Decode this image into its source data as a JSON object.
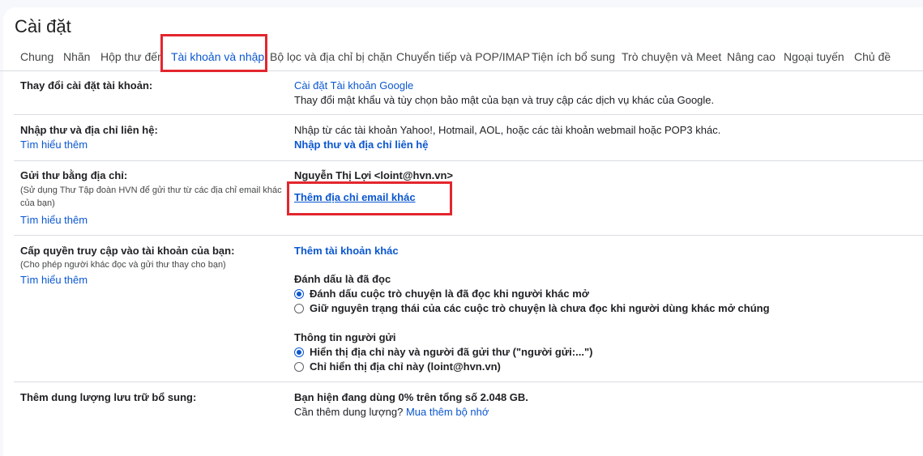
{
  "header": {
    "title": "Cài đặt"
  },
  "tabs": [
    {
      "label": "Chung",
      "active": false
    },
    {
      "label": "Nhãn",
      "active": false
    },
    {
      "label": "Hộp thư đến",
      "active": false
    },
    {
      "label": "Tài khoản và nhập",
      "active": true
    },
    {
      "label": "Bộ lọc và địa chỉ bị chặn",
      "active": false
    },
    {
      "label": "Chuyển tiếp và POP/IMAP",
      "active": false
    },
    {
      "label": "Tiện ích bổ sung",
      "active": false
    },
    {
      "label": "Trò chuyện và Meet",
      "active": false
    },
    {
      "label": "Nâng cao",
      "active": false
    },
    {
      "label": "Ngoại tuyến",
      "active": false
    },
    {
      "label": "Chủ đề",
      "active": false
    }
  ],
  "sections": {
    "change_account": {
      "label": "Thay đổi cài đặt tài khoản:",
      "link": "Cài đặt Tài khoản Google",
      "desc": "Thay đổi mật khẩu và tùy chọn bảo mật của bạn và truy cập các dịch vụ khác của Google."
    },
    "import": {
      "label": "Nhập thư và địa chỉ liên hệ:",
      "learn": "Tìm hiểu thêm",
      "desc": "Nhập từ các tài khoản Yahoo!, Hotmail, AOL, hoặc các tài khoản webmail hoặc POP3 khác.",
      "link": "Nhập thư và địa chỉ liên hệ"
    },
    "send_as": {
      "label": "Gửi thư bằng địa chỉ:",
      "sub": "(Sử dụng Thư Tập đoàn HVN để gửi thư từ các địa chỉ email khác của bạn)",
      "learn": "Tìm hiểu thêm",
      "address": "Nguyễn Thị Lợi <loint@hvn.vn>",
      "add_link": "Thêm địa chỉ email khác"
    },
    "grant": {
      "label": "Cấp quyền truy cập vào tài khoản của bạn:",
      "sub": "(Cho phép người khác đọc và gửi thư thay cho bạn)",
      "learn": "Tìm hiểu thêm",
      "add_link": "Thêm tài khoản khác",
      "mark_heading": "Đánh dấu là đã đọc",
      "mark_opt1": "Đánh dấu cuộc trò chuyện là đã đọc khi người khác mở",
      "mark_opt2": "Giữ nguyên trạng thái của các cuộc trò chuyện là chưa đọc khi người dùng khác mở chúng",
      "sender_heading": "Thông tin người gửi",
      "sender_opt1": "Hiển thị địa chỉ này và người đã gửi thư (\"người gửi:...\")",
      "sender_opt2": "Chỉ hiển thị địa chỉ này (loint@hvn.vn)"
    },
    "storage": {
      "label": "Thêm dung lượng lưu trữ bổ sung:",
      "usage": "Bạn hiện đang dùng 0% trên tổng số 2.048 GB.",
      "need": "Cần thêm dung lượng?",
      "buy_link": "Mua thêm bộ nhớ"
    }
  },
  "colors": {
    "accent": "#0b57d0",
    "highlight_box": "#e3262e"
  }
}
